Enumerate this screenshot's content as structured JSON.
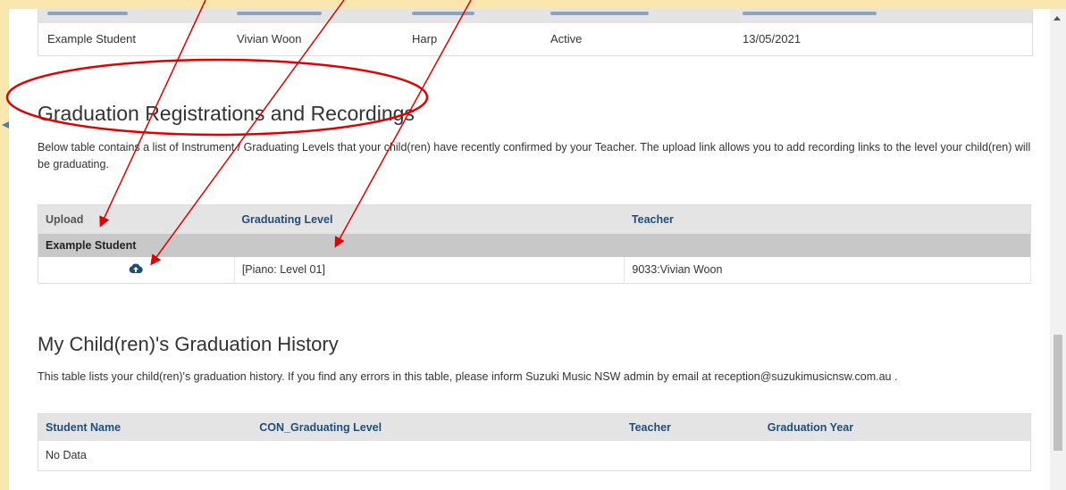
{
  "top_table": {
    "row": {
      "student": "Example Student",
      "teacher": "Vivian Woon",
      "instrument": "Harp",
      "status": "Active",
      "date": "13/05/2021"
    }
  },
  "registrations": {
    "heading": "Graduation Registrations and Recordings",
    "description": "Below table contains a list of Instrument / Graduating Levels that your child(ren) have recently confirmed by your Teacher. The upload link allows you to add recording links to the level your child(ren) will be graduating.",
    "columns": [
      "Upload",
      "Graduating Level",
      "Teacher"
    ],
    "group_label": "Example Student",
    "rows": [
      {
        "upload_icon": "cloud-upload-icon",
        "level": "[Piano: Level 01]",
        "teacher": "9033:Vivian Woon"
      }
    ]
  },
  "history": {
    "heading": "My Child(ren)'s Graduation History",
    "description": "This table lists your child(ren)'s graduation history. If you find any errors in this table, please inform Suzuki Music NSW admin by email at reception@suzukimusicnsw.com.au .",
    "columns": [
      "Student Name",
      "CON_Graduating Level",
      "Teacher",
      "Graduation Year"
    ],
    "empty_text": "No Data"
  },
  "colors": {
    "frame_background": "#fbe6ad",
    "header_text": "#1f4e79",
    "annotation": "#e00000"
  }
}
